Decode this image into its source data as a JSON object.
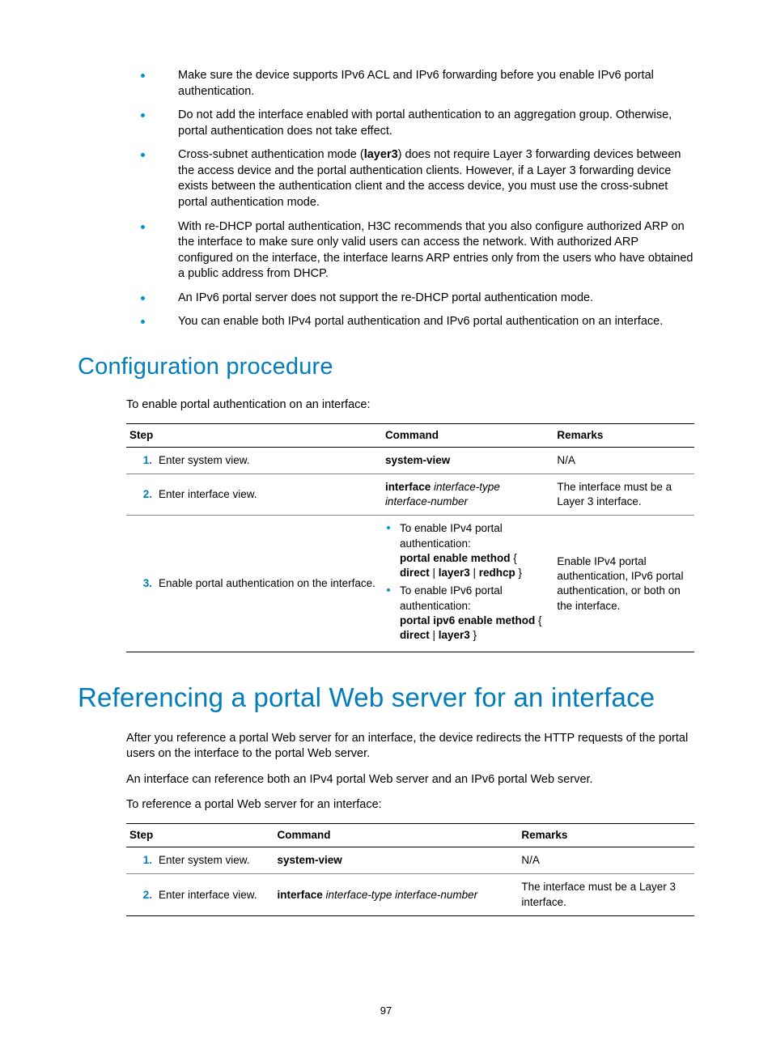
{
  "bullets": [
    {
      "text": "Make sure the device supports IPv6 ACL and IPv6 forwarding before you enable IPv6 portal authentication."
    },
    {
      "text": "Do not add the interface enabled with portal authentication to an aggregation group. Otherwise, portal authentication does not take effect."
    },
    {
      "pre": "Cross-subnet authentication mode (",
      "bold": "layer3",
      "post": ") does not require Layer 3 forwarding devices between the access device and the portal authentication clients. However, if a Layer 3 forwarding device exists between the authentication client and the access device, you must use the cross-subnet portal authentication mode."
    },
    {
      "text": "With re-DHCP portal authentication, H3C recommends that you also configure authorized ARP on the interface to make sure only valid users can access the network. With authorized ARP configured on the interface, the interface learns ARP entries only from the users who have obtained a public address from DHCP."
    },
    {
      "text": "An IPv6 portal server does not support the re-DHCP portal authentication mode."
    },
    {
      "text": "You can enable both IPv4 portal authentication and IPv6 portal authentication on an interface."
    }
  ],
  "section1": {
    "heading": "Configuration procedure",
    "intro": "To enable portal authentication on an interface:",
    "headers": {
      "step": "Step",
      "command": "Command",
      "remarks": "Remarks"
    },
    "rows": [
      {
        "num": "1.",
        "step": "Enter system view.",
        "command_bold": "system-view",
        "remarks": "N/A"
      },
      {
        "num": "2.",
        "step": "Enter interface view.",
        "command_bold": "interface",
        "command_italic": " interface-type interface-number",
        "remarks": "The interface must be a Layer 3 interface."
      },
      {
        "num": "3.",
        "step": "Enable portal authentication on the interface.",
        "sub": [
          {
            "lead": "To enable IPv4 portal authentication:",
            "cmd_pre": "portal enable method",
            "cmd_post": " { ",
            "opt1": "direct",
            "sep1": " | ",
            "opt2": "layer3",
            "sep2": " | ",
            "opt3": "redhcp",
            "close": " }"
          },
          {
            "lead": "To enable IPv6 portal authentication:",
            "cmd_pre": "portal ipv6 enable method",
            "cmd_post": " { ",
            "opt1": "direct",
            "sep1": " | ",
            "opt2": "layer3",
            "close": " }"
          }
        ],
        "remarks": "Enable IPv4 portal authentication, IPv6 portal authentication, or both on the interface."
      }
    ]
  },
  "section2": {
    "heading": "Referencing a portal Web server for an interface",
    "p1": "After you reference a portal Web server for an interface, the device redirects the HTTP requests of the portal users on the interface to the portal Web server.",
    "p2": "An interface can reference both an IPv4 portal Web server and an IPv6 portal Web server.",
    "p3": "To reference a portal Web server for an interface:",
    "headers": {
      "step": "Step",
      "command": "Command",
      "remarks": "Remarks"
    },
    "rows": [
      {
        "num": "1.",
        "step": "Enter system view.",
        "command_bold": "system-view",
        "remarks": "N/A"
      },
      {
        "num": "2.",
        "step": "Enter interface view.",
        "command_bold": "interface",
        "command_italic": " interface-type interface-number",
        "remarks": "The interface must be a Layer 3 interface."
      }
    ]
  },
  "page_number": "97"
}
